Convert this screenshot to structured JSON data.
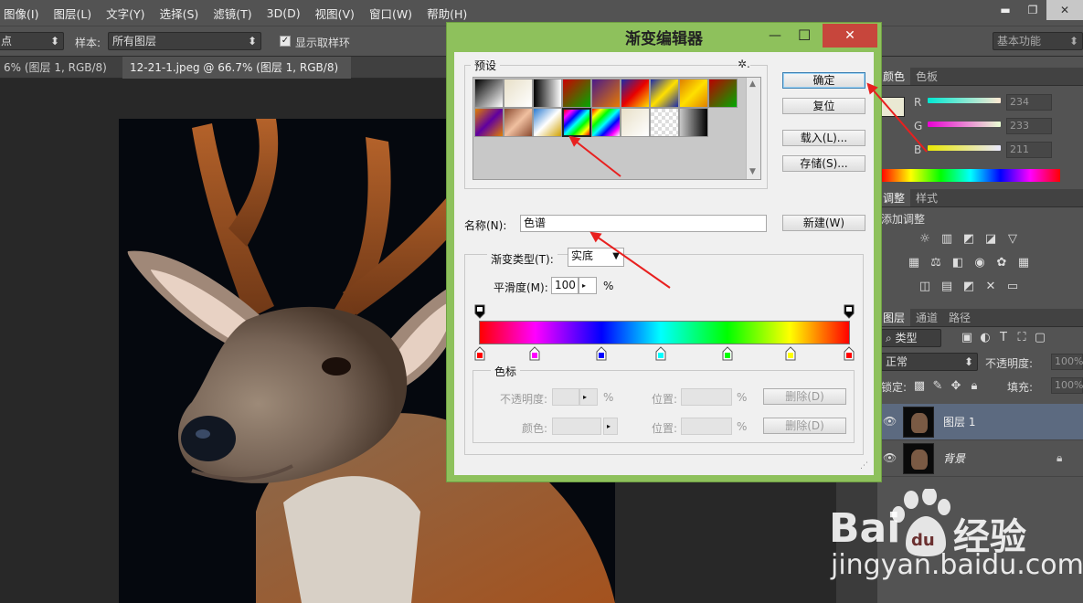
{
  "menubar": {
    "items": [
      "图像(I)",
      "图层(L)",
      "文字(Y)",
      "选择(S)",
      "滤镜(T)",
      "3D(D)",
      "视图(V)",
      "窗口(W)",
      "帮助(H)"
    ]
  },
  "window_controls": {
    "minimize": "▬",
    "restore": "❐",
    "close": "✕"
  },
  "options_bar": {
    "first_select": "点",
    "sample_label": "样本:",
    "sample_value": "所有图层",
    "checkbox_label": "显示取样环",
    "workspace": "基本功能"
  },
  "tabs": [
    {
      "label": "6% (图层 1, RGB/8) *",
      "close": "×"
    },
    {
      "label": "12-21-1.jpeg @ 66.7% (图层 1, RGB/8) *",
      "close": "×"
    }
  ],
  "dialog": {
    "title": "渐变编辑器",
    "title_buttons": {
      "minimize": "—",
      "maximize": "☐",
      "close": "✕"
    },
    "presets_label": "预设",
    "gear": "✲.",
    "buttons": {
      "ok": "确定",
      "reset": "复位",
      "load": "载入(L)...",
      "save": "存储(S)...",
      "new": "新建(W)"
    },
    "name_label": "名称(N):",
    "name_value": "色谱",
    "type_label": "渐变类型(T):",
    "type_value": "实底",
    "smooth_label": "平滑度(M):",
    "smooth_value": "100",
    "smooth_unit": "%",
    "stops_label": "色标",
    "opacity_label": "不透明度:",
    "location_label": "位置:",
    "color_label": "颜色:",
    "percent": "%",
    "delete_label": "删除(D)",
    "gradient_stop_colors": [
      "#ff0000",
      "#ff00ff",
      "#0000ff",
      "#00ffff",
      "#00ff00",
      "#ffff00",
      "#ff0000"
    ]
  },
  "panels": {
    "color_tabs": [
      "颜色",
      "色板"
    ],
    "channels": [
      {
        "label": "R",
        "value": "234"
      },
      {
        "label": "G",
        "value": "233"
      },
      {
        "label": "B",
        "value": "211"
      }
    ],
    "adjust_tabs": [
      "调整",
      "样式"
    ],
    "adjust_hint": "添加调整",
    "layers_tabs": [
      "图层",
      "通道",
      "路径"
    ],
    "filter_kind": "类型",
    "blend_mode": "正常",
    "opacity_label": "不透明度:",
    "opacity_value": "100%",
    "lock_label": "锁定:",
    "fill_label": "填充:",
    "fill_value": "100%",
    "layers": [
      {
        "name": "图层 1",
        "selected": true
      },
      {
        "name": "背景",
        "locked": true
      }
    ]
  },
  "watermark": {
    "brand_left": "Bai",
    "brand_right": "经验",
    "url": "jingyan.baidu.com"
  }
}
